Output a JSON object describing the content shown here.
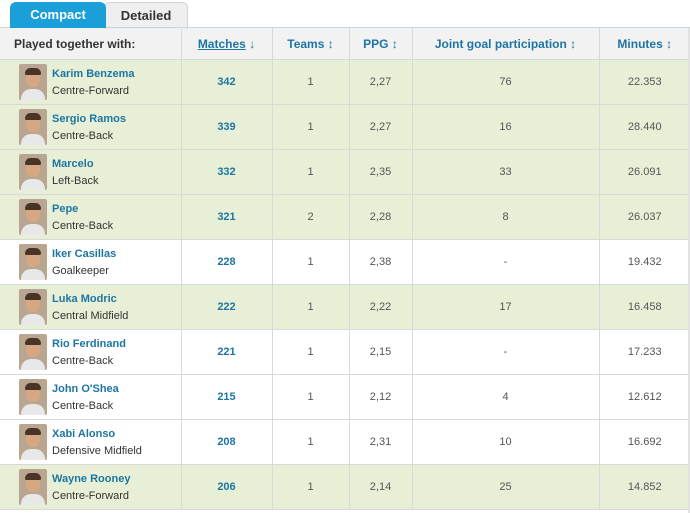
{
  "tabs": [
    {
      "label": "Compact",
      "active": true
    },
    {
      "label": "Detailed",
      "active": false
    }
  ],
  "columns": {
    "player": "Played together with:",
    "matches": "Matches",
    "teams": "Teams",
    "ppg": "PPG",
    "joint_goal": "Joint goal participation",
    "minutes": "Minutes"
  },
  "sort_icons": {
    "matches": "↓",
    "teams": "↕",
    "ppg": "↕",
    "joint_goal": "↕",
    "minutes": "↕"
  },
  "colors": {
    "accent": "#1a9fd8",
    "link": "#1d75a3",
    "highlight_row": "#e7f0d7"
  },
  "rows": [
    {
      "name": "Karim Benzema",
      "position": "Centre-Forward",
      "matches": "342",
      "teams": "1",
      "ppg": "2,27",
      "joint_goal": "76",
      "minutes": "22.353",
      "highlight": true
    },
    {
      "name": "Sergio Ramos",
      "position": "Centre-Back",
      "matches": "339",
      "teams": "1",
      "ppg": "2,27",
      "joint_goal": "16",
      "minutes": "28.440",
      "highlight": true
    },
    {
      "name": "Marcelo",
      "position": "Left-Back",
      "matches": "332",
      "teams": "1",
      "ppg": "2,35",
      "joint_goal": "33",
      "minutes": "26.091",
      "highlight": true
    },
    {
      "name": "Pepe",
      "position": "Centre-Back",
      "matches": "321",
      "teams": "2",
      "ppg": "2,28",
      "joint_goal": "8",
      "minutes": "26.037",
      "highlight": true
    },
    {
      "name": "Iker Casillas",
      "position": "Goalkeeper",
      "matches": "228",
      "teams": "1",
      "ppg": "2,38",
      "joint_goal": "-",
      "minutes": "19.432",
      "highlight": false
    },
    {
      "name": "Luka Modric",
      "position": "Central Midfield",
      "matches": "222",
      "teams": "1",
      "ppg": "2,22",
      "joint_goal": "17",
      "minutes": "16.458",
      "highlight": true
    },
    {
      "name": "Rio Ferdinand",
      "position": "Centre-Back",
      "matches": "221",
      "teams": "1",
      "ppg": "2,15",
      "joint_goal": "-",
      "minutes": "17.233",
      "highlight": false
    },
    {
      "name": "John O'Shea",
      "position": "Centre-Back",
      "matches": "215",
      "teams": "1",
      "ppg": "2,12",
      "joint_goal": "4",
      "minutes": "12.612",
      "highlight": false
    },
    {
      "name": "Xabi Alonso",
      "position": "Defensive Midfield",
      "matches": "208",
      "teams": "1",
      "ppg": "2,31",
      "joint_goal": "10",
      "minutes": "16.692",
      "highlight": false
    },
    {
      "name": "Wayne Rooney",
      "position": "Centre-Forward",
      "matches": "206",
      "teams": "1",
      "ppg": "2,14",
      "joint_goal": "25",
      "minutes": "14.852",
      "highlight": true
    }
  ]
}
